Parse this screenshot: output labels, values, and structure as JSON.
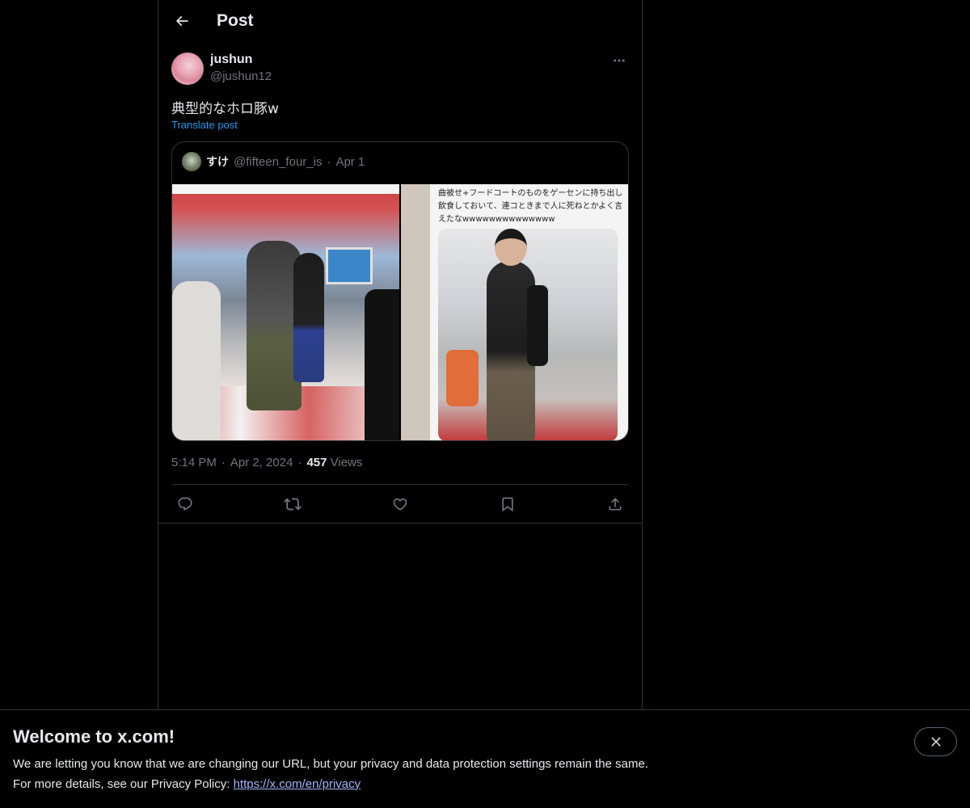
{
  "header": {
    "title": "Post"
  },
  "post": {
    "author_name": "jushun",
    "author_handle": "@jushun12",
    "text": "典型的なホロ豚w",
    "translate_label": "Translate post",
    "time": "5:14 PM",
    "date": "Apr 2, 2024",
    "views_count": "457",
    "views_label": "Views",
    "separator": "·"
  },
  "quote": {
    "author_name": "すけ",
    "author_handle": "@fifteen_four_is",
    "date": "Apr 1",
    "separator": "·",
    "image_caption": "曲被せ+フードコートのものをゲーセンに持ち出し飲食しておいて、連コときまで人に死ねとかよく言えたなwwwwwwwwwwwwww"
  },
  "actions": [
    "reply-icon",
    "repost-icon",
    "like-icon",
    "bookmark-icon",
    "share-icon"
  ],
  "banner": {
    "title": "Welcome to x.com!",
    "line1": "We are letting you know that we are changing our URL, but your privacy and data protection settings remain the same.",
    "line2_prefix": "For more details, see our Privacy Policy: ",
    "link": "https://x.com/en/privacy"
  },
  "colors": {
    "background": "#000000",
    "text": "#e7e9ea",
    "muted": "#71767b",
    "accent": "#1d9bf0",
    "border": "#2f3336"
  }
}
